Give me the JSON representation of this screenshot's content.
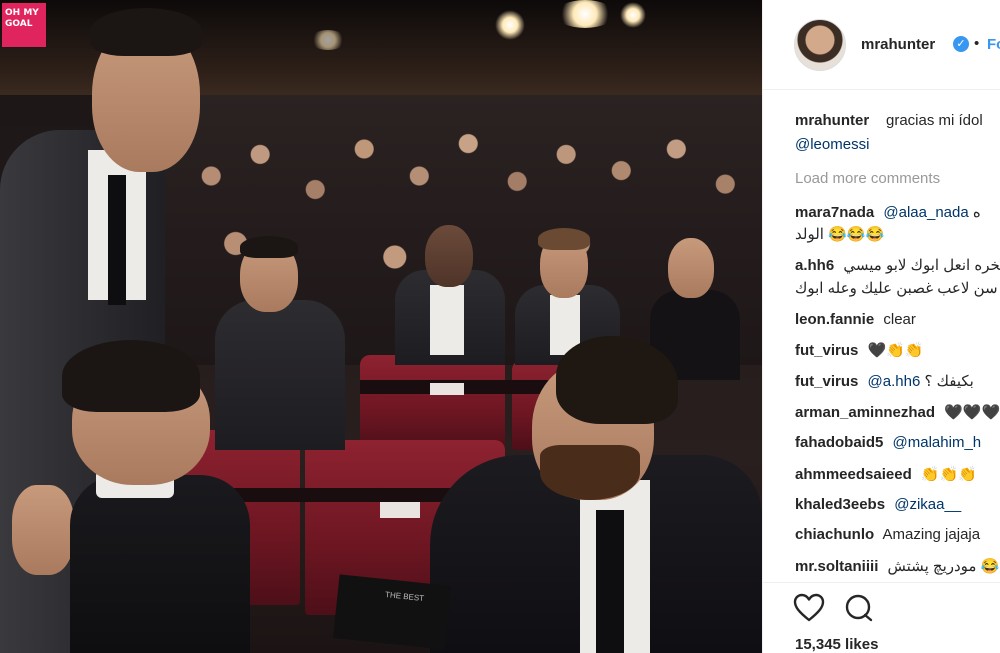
{
  "brand": {
    "logo_text": "OH MY GOAL"
  },
  "post_header": {
    "username": "mrahunter",
    "verified_icon": "verified-badge-icon",
    "separator": "•",
    "follow_label": "Fo"
  },
  "caption": {
    "username": "mrahunter",
    "text": "gracias mi ídol",
    "mention": "@leomessi"
  },
  "load_more_label": "Load more comments",
  "comments": [
    {
      "user": "mara7nada",
      "mention": "@alaa_nada",
      "text": "ه",
      "line2": "الولد 😂😂😂"
    },
    {
      "user": "a.hh6",
      "text": "الخره انعل ابوك لابو ميسي",
      "line2": "سن لاعب غصبن عليك وعله ابوك"
    },
    {
      "user": "leon.fannie",
      "text": "clear"
    },
    {
      "user": "fut_virus",
      "text": "🖤👏👏"
    },
    {
      "user": "fut_virus",
      "mention": "@a.hh6",
      "text": "بكيفك ؟"
    },
    {
      "user": "arman_aminnezhad",
      "text": "🖤🖤🖤"
    },
    {
      "user": "fahadobaid5",
      "mention": "@malahim_h",
      "text": ""
    },
    {
      "user": "ahmmeedsaieed",
      "text": "👏👏👏"
    },
    {
      "user": "khaled3eebs",
      "mention": "@zikaa__",
      "text": ""
    },
    {
      "user": "chiachunlo",
      "text": "Amazing jajaja"
    },
    {
      "user": "mr.soltaniiii",
      "text": "مودريچ پشتش 😂"
    }
  ],
  "actions": {
    "like_icon": "heart-icon",
    "comment_icon": "comment-bubble-icon"
  },
  "likes_label": "15,345 likes",
  "photo": {
    "program_label": "THE BEST"
  }
}
